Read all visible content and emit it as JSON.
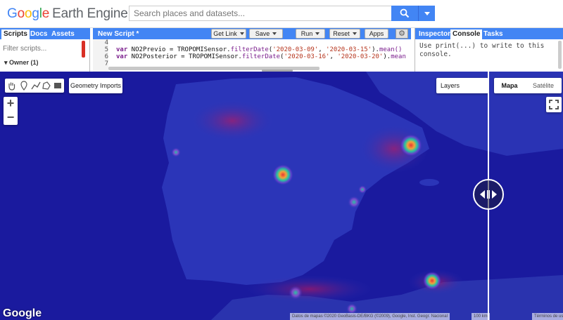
{
  "header": {
    "logo_letters": [
      "G",
      "o",
      "o",
      "g",
      "l",
      "e"
    ],
    "logo_product": "Earth Engine",
    "search_placeholder": "Search places and datasets..."
  },
  "left_panel": {
    "tabs": [
      "Scripts",
      "Docs",
      "Assets"
    ],
    "filter_placeholder": "Filter scripts...",
    "owner_label": "▾ Owner (1)"
  },
  "editor": {
    "title": "New Script *",
    "buttons": {
      "get_link": "Get Link",
      "save": "Save",
      "run": "Run",
      "reset": "Reset",
      "apps": "Apps"
    },
    "line_numbers": [
      "4",
      "5",
      "6",
      "7"
    ],
    "lines": [
      {
        "kw": "var",
        "name": " NO2Previo = TROPOMISensor.",
        "fn": "filterDate",
        "p1": "(",
        "s1": "'2020-03-09'",
        "c": ", ",
        "s2": "'2020-03-15'",
        "end": ").",
        "tail": "mean()"
      },
      {
        "kw": "var",
        "name": " NO2Posterior = TROPOMISensor.",
        "fn": "filterDate",
        "p1": "(",
        "s1": "'2020-03-16'",
        "c": ", ",
        "s2": "'2020-03-20'",
        "end": ").",
        "tail": "mean"
      }
    ]
  },
  "right_panel": {
    "tabs": [
      "Inspector",
      "Console",
      "Tasks"
    ],
    "console_text": "Use print(...) to write to this console."
  },
  "map": {
    "geometry_imports_label": "Geometry Imports",
    "zoom_in": "+",
    "zoom_out": "−",
    "layers_label": "Layers",
    "map_types": [
      "Mapa",
      "Satélite"
    ],
    "google_mark": "Google",
    "attribution": "Datos de mapas ©2020 GeoBasis-DE/BKG (©2009), Google, Inst. Geogr. Nacional",
    "scale_label": "100 km",
    "terms_label": "Términos de uso"
  },
  "colors": {
    "accent": "#4285f4",
    "ocean": "#1a1a9e",
    "land": "#2b35b8",
    "hotspot_red": "#e53935",
    "hotspot_green": "#26c6a0"
  }
}
